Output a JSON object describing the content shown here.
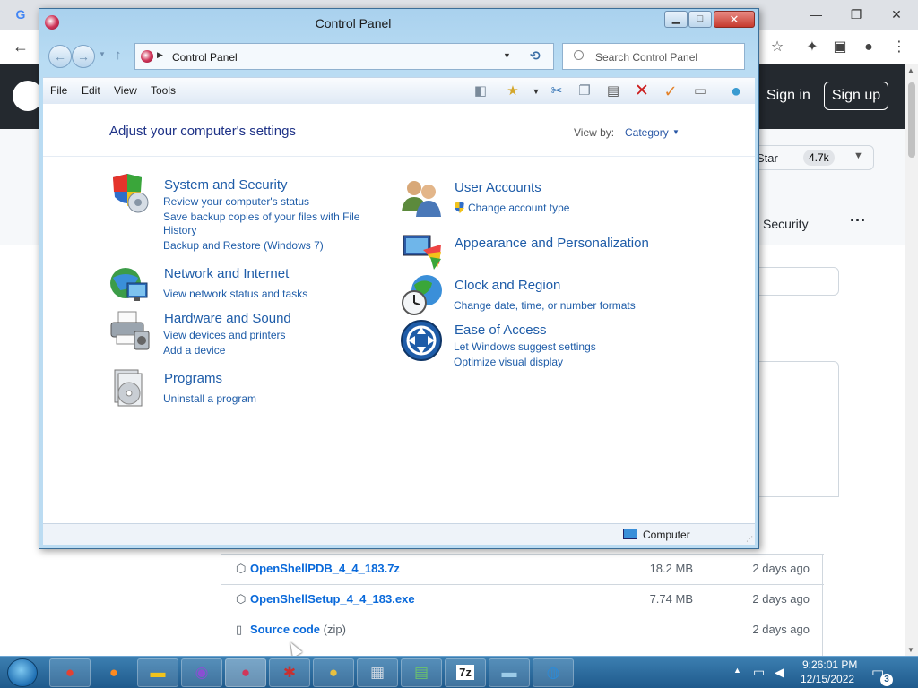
{
  "browser": {
    "window_controls": {
      "minimize": "—",
      "restore": "❐",
      "close": "✕"
    },
    "github": {
      "sign_in": "Sign in",
      "sign_up": "Sign up",
      "star_label": "Star",
      "star_count": "4.7k",
      "security_tab": "Security",
      "more": "···",
      "assets": [
        {
          "name": "OpenShellPDB_4_4_183.7z",
          "suffix": "",
          "size": "18.2 MB",
          "date": "2 days ago"
        },
        {
          "name": "OpenShellSetup_4_4_183.exe",
          "suffix": "",
          "size": "7.74 MB",
          "date": "2 days ago"
        },
        {
          "name": "Source code",
          "suffix": " (zip)",
          "size": "",
          "date": "2 days ago"
        }
      ]
    }
  },
  "control_panel": {
    "title": "Control Panel",
    "address": "Control Panel",
    "search_placeholder": "Search Control Panel",
    "menu": {
      "file": "File",
      "edit": "Edit",
      "view": "View",
      "tools": "Tools"
    },
    "heading": "Adjust your computer's settings",
    "view_by_label": "View by:",
    "view_by_value": "Category",
    "categories": [
      {
        "title": "System and Security",
        "links": [
          "Review your computer's status",
          "Save backup copies of your files with File",
          "History",
          "Backup and Restore (Windows 7)"
        ]
      },
      {
        "title": "Network and Internet",
        "links": [
          "View network status and tasks"
        ]
      },
      {
        "title": "Hardware and Sound",
        "links": [
          "View devices and printers",
          "Add a device"
        ]
      },
      {
        "title": "Programs",
        "links": [
          "Uninstall a program"
        ]
      },
      {
        "title": "User Accounts",
        "links": [
          "Change account type"
        ]
      },
      {
        "title": "Appearance and Personalization",
        "links": []
      },
      {
        "title": "Clock and Region",
        "links": [
          "Change date, time, or number formats"
        ]
      },
      {
        "title": "Ease of Access",
        "links": [
          "Let Windows suggest settings",
          "Optimize visual display"
        ]
      }
    ],
    "status": "Computer"
  },
  "taskbar": {
    "apps": [
      "chrome-icon",
      "firefox-icon",
      "explorer-icon",
      "media-icon",
      "control-panel-icon",
      "app-icon",
      "app-icon",
      "app-icon",
      "app-icon",
      "7zip-icon",
      "app-icon",
      "app-icon"
    ],
    "seven_zip_label": "7z",
    "time": "9:26:01 PM",
    "date": "12/15/2022",
    "notification_count": "3"
  },
  "colors": {
    "link": "#1e5ca8",
    "heading": "#1e3287",
    "taskbar": "#1f5a8c",
    "github_header": "#24292f"
  }
}
